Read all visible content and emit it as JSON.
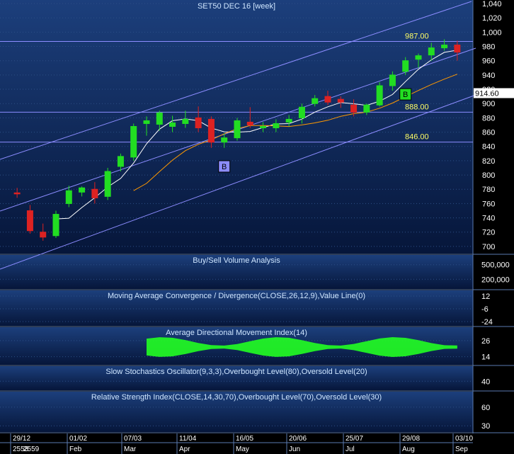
{
  "colors": {
    "panel_top": "#1c3f7c",
    "panel_bottom": "#06163a",
    "grid": "#2c4f86",
    "text": "#ffffff",
    "title": "#cfe6ff",
    "up": "#22dd22",
    "down": "#dd2222",
    "channel": "#8c8cff",
    "ma_short": "#ffffff",
    "ma_long": "#ff9900",
    "adx_fill": "#22ff22",
    "level_label": "#ffff66",
    "current_bg": "#ffffff",
    "signal_bg": "#8c8cff"
  },
  "chart_data": [
    {
      "type": "candlestick",
      "title": "SET50 DEC 16  [week]",
      "ylim": [
        690,
        1045
      ],
      "y_ticks": [
        700,
        720,
        740,
        760,
        780,
        800,
        820,
        840,
        860,
        880,
        900,
        920,
        940,
        960,
        980,
        1000,
        1020,
        1040
      ],
      "y_tick_labels": [
        "700",
        "720",
        "740",
        "760",
        "780",
        "800",
        "820",
        "840",
        "860",
        "880",
        "900",
        "920",
        "940",
        "960",
        "980",
        "1,000",
        "1,020",
        "1,040"
      ],
      "current_price": 914.6,
      "current_price_label": "914.60",
      "horizontal_levels": [
        {
          "value": 987,
          "label": "987.00"
        },
        {
          "value": 888,
          "label": "888.00"
        },
        {
          "value": 846,
          "label": "846.00"
        }
      ],
      "signals": [
        {
          "label": "B",
          "index": 16,
          "value": 812
        },
        {
          "label": "B",
          "index": 30,
          "value": 913
        }
      ],
      "candles": [
        {
          "o": 775,
          "h": 782,
          "l": 768,
          "c": 774
        },
        {
          "o": 750,
          "h": 758,
          "l": 718,
          "c": 722
        },
        {
          "o": 720,
          "h": 732,
          "l": 708,
          "c": 713
        },
        {
          "o": 715,
          "h": 750,
          "l": 712,
          "c": 745
        },
        {
          "o": 760,
          "h": 785,
          "l": 755,
          "c": 778
        },
        {
          "o": 776,
          "h": 784,
          "l": 770,
          "c": 782
        },
        {
          "o": 780,
          "h": 790,
          "l": 760,
          "c": 768
        },
        {
          "o": 770,
          "h": 810,
          "l": 765,
          "c": 805
        },
        {
          "o": 812,
          "h": 830,
          "l": 805,
          "c": 826
        },
        {
          "o": 825,
          "h": 872,
          "l": 820,
          "c": 868
        },
        {
          "o": 872,
          "h": 882,
          "l": 855,
          "c": 876
        },
        {
          "o": 871,
          "h": 890,
          "l": 862,
          "c": 887
        },
        {
          "o": 868,
          "h": 883,
          "l": 860,
          "c": 873
        },
        {
          "o": 872,
          "h": 890,
          "l": 866,
          "c": 878
        },
        {
          "o": 880,
          "h": 896,
          "l": 860,
          "c": 866
        },
        {
          "o": 878,
          "h": 882,
          "l": 838,
          "c": 846
        },
        {
          "o": 846,
          "h": 858,
          "l": 838,
          "c": 852
        },
        {
          "o": 852,
          "h": 880,
          "l": 848,
          "c": 876
        },
        {
          "o": 874,
          "h": 895,
          "l": 866,
          "c": 870
        },
        {
          "o": 866,
          "h": 874,
          "l": 860,
          "c": 868
        },
        {
          "o": 866,
          "h": 878,
          "l": 860,
          "c": 872
        },
        {
          "o": 874,
          "h": 884,
          "l": 868,
          "c": 878
        },
        {
          "o": 880,
          "h": 900,
          "l": 872,
          "c": 895
        },
        {
          "o": 900,
          "h": 912,
          "l": 896,
          "c": 907
        },
        {
          "o": 910,
          "h": 918,
          "l": 898,
          "c": 902
        },
        {
          "o": 906,
          "h": 910,
          "l": 894,
          "c": 902
        },
        {
          "o": 898,
          "h": 906,
          "l": 882,
          "c": 888
        },
        {
          "o": 888,
          "h": 900,
          "l": 884,
          "c": 898
        },
        {
          "o": 898,
          "h": 930,
          "l": 896,
          "c": 925
        },
        {
          "o": 925,
          "h": 945,
          "l": 918,
          "c": 940
        },
        {
          "o": 945,
          "h": 965,
          "l": 940,
          "c": 960
        },
        {
          "o": 962,
          "h": 970,
          "l": 950,
          "c": 967
        },
        {
          "o": 968,
          "h": 985,
          "l": 960,
          "c": 978
        },
        {
          "o": 978,
          "h": 990,
          "l": 974,
          "c": 982
        },
        {
          "o": 982,
          "h": 988,
          "l": 960,
          "c": 972
        }
      ]
    },
    {
      "type": "bar",
      "title": "Buy/Sell Volume Analysis",
      "y_tick_labels": [
        "500,000",
        "200,000"
      ],
      "y_tick_values": [
        500000,
        200000
      ],
      "ylim": [
        0,
        700000
      ]
    },
    {
      "type": "line",
      "title": "Moving Average Convergence / Divergence(CLOSE,26,12,9),Value Line(0)",
      "y_tick_labels": [
        "12",
        "-6",
        "-24"
      ],
      "y_tick_values": [
        12,
        -6,
        -24
      ],
      "ylim": [
        -30,
        20
      ]
    },
    {
      "type": "area",
      "title": "Average Directional Movement Index(14)",
      "y_tick_labels": [
        "26",
        "14"
      ],
      "y_tick_values": [
        26,
        14
      ],
      "ylim": [
        8,
        36
      ]
    },
    {
      "type": "line",
      "title": "Slow Stochastics Oscillator(9,3,3),Overbought Level(80),Oversold Level(20)",
      "y_tick_labels": [
        "40"
      ],
      "y_tick_values": [
        40
      ],
      "ylim": [
        10,
        90
      ]
    },
    {
      "type": "line",
      "title": "Relative Strength Index(CLOSE,14,30,70),Overbought Level(70),Oversold Level(30)",
      "y_tick_labels": [
        "60",
        "30"
      ],
      "y_tick_values": [
        60,
        30
      ],
      "ylim": [
        20,
        85
      ]
    }
  ],
  "time_axis": {
    "dates": [
      "29/12",
      "01/02",
      "07/03",
      "11/04",
      "16/05",
      "20/06",
      "25/07",
      "29/08",
      "03/10"
    ],
    "months": [
      "2559",
      "Feb",
      "Mar",
      "Apr",
      "May",
      "Jun",
      "Jul",
      "Aug",
      "Sep"
    ],
    "year_overlap": "2558"
  }
}
